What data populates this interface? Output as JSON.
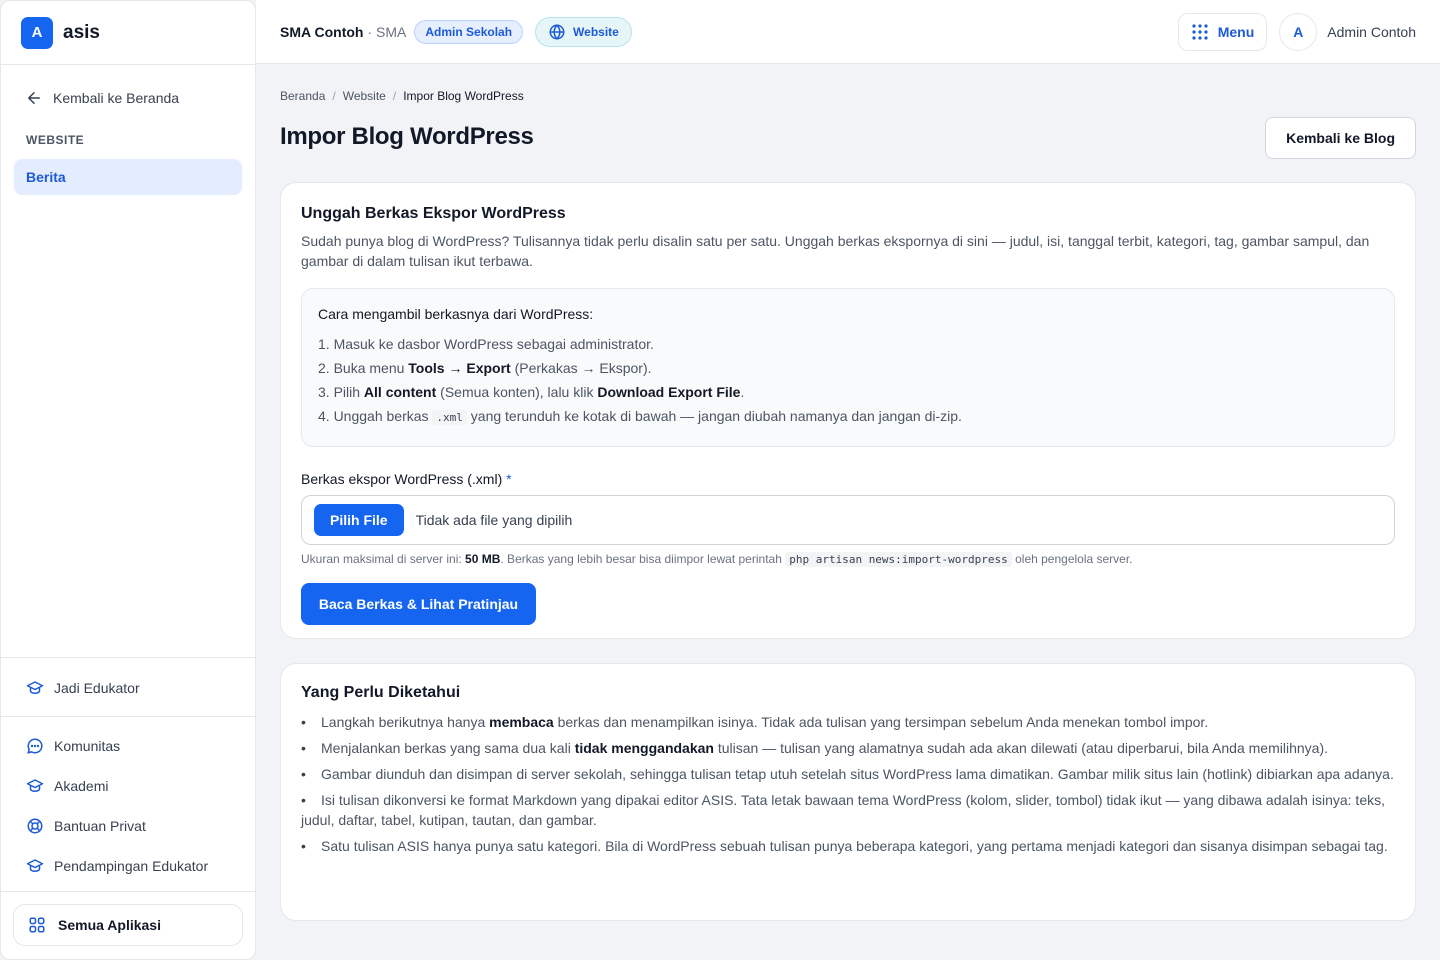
{
  "brand": {
    "logo_letter": "A",
    "name": "asis"
  },
  "sidebar": {
    "back_label": "Kembali ke Beranda",
    "section_label": "WEBSITE",
    "active_item": "Berita",
    "bottom_items": [
      {
        "label": "Jadi Edukator",
        "icon": "graduation-icon"
      },
      {
        "label": "Komunitas",
        "icon": "chat-icon"
      },
      {
        "label": "Akademi",
        "icon": "graduation-icon"
      },
      {
        "label": "Bantuan Privat",
        "icon": "lifebuoy-icon"
      },
      {
        "label": "Pendampingan Edukator",
        "icon": "graduation-icon"
      }
    ],
    "all_apps_label": "Semua Aplikasi"
  },
  "topbar": {
    "school_name": "SMA Contoh",
    "school_type": "· SMA",
    "role_badge": "Admin Sekolah",
    "website_pill": "Website",
    "menu_label": "Menu",
    "avatar_letter": "A",
    "user_name": "Admin Contoh"
  },
  "breadcrumb": {
    "items": [
      "Beranda",
      "Website"
    ],
    "current": "Impor Blog WordPress",
    "separator": "/"
  },
  "page": {
    "title": "Impor Blog WordPress",
    "back_button": "Kembali ke Blog"
  },
  "upload_card": {
    "title": "Unggah Berkas Ekspor WordPress",
    "description": "Sudah punya blog di WordPress? Tulisannya tidak perlu disalin satu per satu. Unggah berkas ekspornya di sini — judul, isi, tanggal terbit, kategori, tag, gambar sampul, dan gambar di dalam tulisan ikut terbawa.",
    "howto_title": "Cara mengambil berkasnya dari WordPress:",
    "steps": {
      "s1": "1. Masuk ke dasbor WordPress sebagai administrator.",
      "s2_a": "2. Buka menu ",
      "s2_b": "Tools → Export",
      "s2_c": " (Perkakas → Ekspor).",
      "s3_a": "3. Pilih ",
      "s3_b": "All content",
      "s3_c": " (Semua konten), lalu klik ",
      "s3_d": "Download Export File",
      "s3_e": ".",
      "s4_a": "4. Unggah berkas ",
      "s4_code": ".xml",
      "s4_b": " yang terunduh ke kotak di bawah — jangan diubah namanya dan jangan di-zip."
    },
    "field_label": "Berkas ekspor WordPress (.xml)",
    "required_mark": "*",
    "file_button": "Pilih File",
    "file_status": "Tidak ada file yang dipilih",
    "hint_a": "Ukuran maksimal di server ini: ",
    "hint_size": "50 MB",
    "hint_b": ". Berkas yang lebih besar bisa diimpor lewat perintah ",
    "hint_code": "php artisan news:import-wordpress",
    "hint_c": " oleh pengelola server.",
    "submit_button": "Baca Berkas & Lihat Pratinjau"
  },
  "notes_card": {
    "title": "Yang Perlu Diketahui",
    "n1_a": "Langkah berikutnya hanya ",
    "n1_b": "membaca",
    "n1_c": " berkas dan menampilkan isinya. Tidak ada tulisan yang tersimpan sebelum Anda menekan tombol impor.",
    "n2_a": "Menjalankan berkas yang sama dua kali ",
    "n2_b": "tidak menggandakan",
    "n2_c": " tulisan — tulisan yang alamatnya sudah ada akan dilewati (atau diperbarui, bila Anda memilihnya).",
    "n3": "Gambar diunduh dan disimpan di server sekolah, sehingga tulisan tetap utuh setelah situs WordPress lama dimatikan. Gambar milik situs lain (hotlink) dibiarkan apa adanya.",
    "n4": "Isi tulisan dikonversi ke format Markdown yang dipakai editor ASIS. Tata letak bawaan tema WordPress (kolom, slider, tombol) tidak ikut — yang dibawa adalah isinya: teks, judul, daftar, tabel, kutipan, tautan, dan gambar.",
    "n5": "Satu tulisan ASIS hanya punya satu kategori. Bila di WordPress sebuah tulisan punya beberapa kategori, yang pertama menjadi kategori dan sisanya disimpan sebagai tag."
  },
  "colors": {
    "primary": "#1565f0",
    "accent_text": "#1d5ad8",
    "active_bg": "#e4edfd",
    "page_bg": "#f1f3f6"
  }
}
